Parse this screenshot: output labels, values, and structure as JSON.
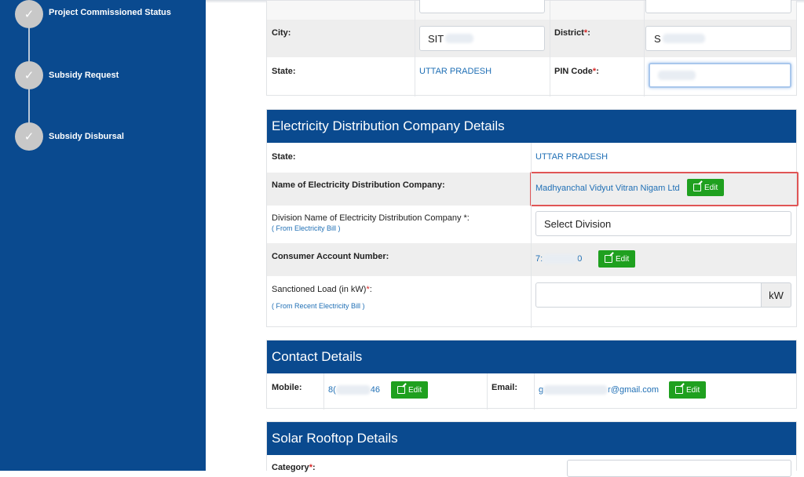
{
  "sidebar": {
    "steps": [
      {
        "label": "Project Commissioned Status",
        "check": "✓"
      },
      {
        "label": "Subsidy Request",
        "check": "✓"
      },
      {
        "label": "Subsidy Disbursal",
        "check": "✓"
      }
    ]
  },
  "address": {
    "city_label": "City:",
    "city_value": "SIT",
    "district_label": "District",
    "district_required": "*",
    "district_colon": ":",
    "district_value": "S",
    "state_label": "State:",
    "state_value": "UTTAR PRADESH",
    "pin_label": "PIN Code",
    "pin_required": "*",
    "pin_colon": ":"
  },
  "discom": {
    "title": "Electricity Distribution Company Details",
    "state_label": "State:",
    "state_value": "UTTAR PRADESH",
    "company_label": "Name of Electricity Distribution Company:",
    "company_value": "Madhyanchal Vidyut Vitran Nigam Ltd",
    "edit_label": "Edit",
    "division_label": "Division Name of Electricity Distribution Company *:",
    "division_hint": "( From Electricity Bill )",
    "division_placeholder": "Select Division",
    "account_label": "Consumer Account Number:",
    "account_prefix": "7:",
    "account_suffix": "0",
    "load_label": "Sanctioned Load (in kW)",
    "load_required": "*",
    "load_colon": ":",
    "load_hint": "( From Recent Electricity Bill )",
    "load_unit": "kW"
  },
  "contact": {
    "title": "Contact Details",
    "mobile_label": "Mobile:",
    "mobile_prefix": "8(",
    "mobile_suffix": "46",
    "email_label": "Email:",
    "email_prefix": "g",
    "email_suffix": "r@gmail.com",
    "edit_label": "Edit"
  },
  "solar": {
    "title": "Solar Rooftop Details",
    "category_label": "Category",
    "category_required": "*",
    "category_colon": ":"
  },
  "colors": {
    "brand_blue": "#0a4a8f",
    "edit_green": "#1fa01f",
    "highlight_red": "#e05555",
    "link_blue": "#1f6fb5",
    "required_red": "#d62828"
  }
}
